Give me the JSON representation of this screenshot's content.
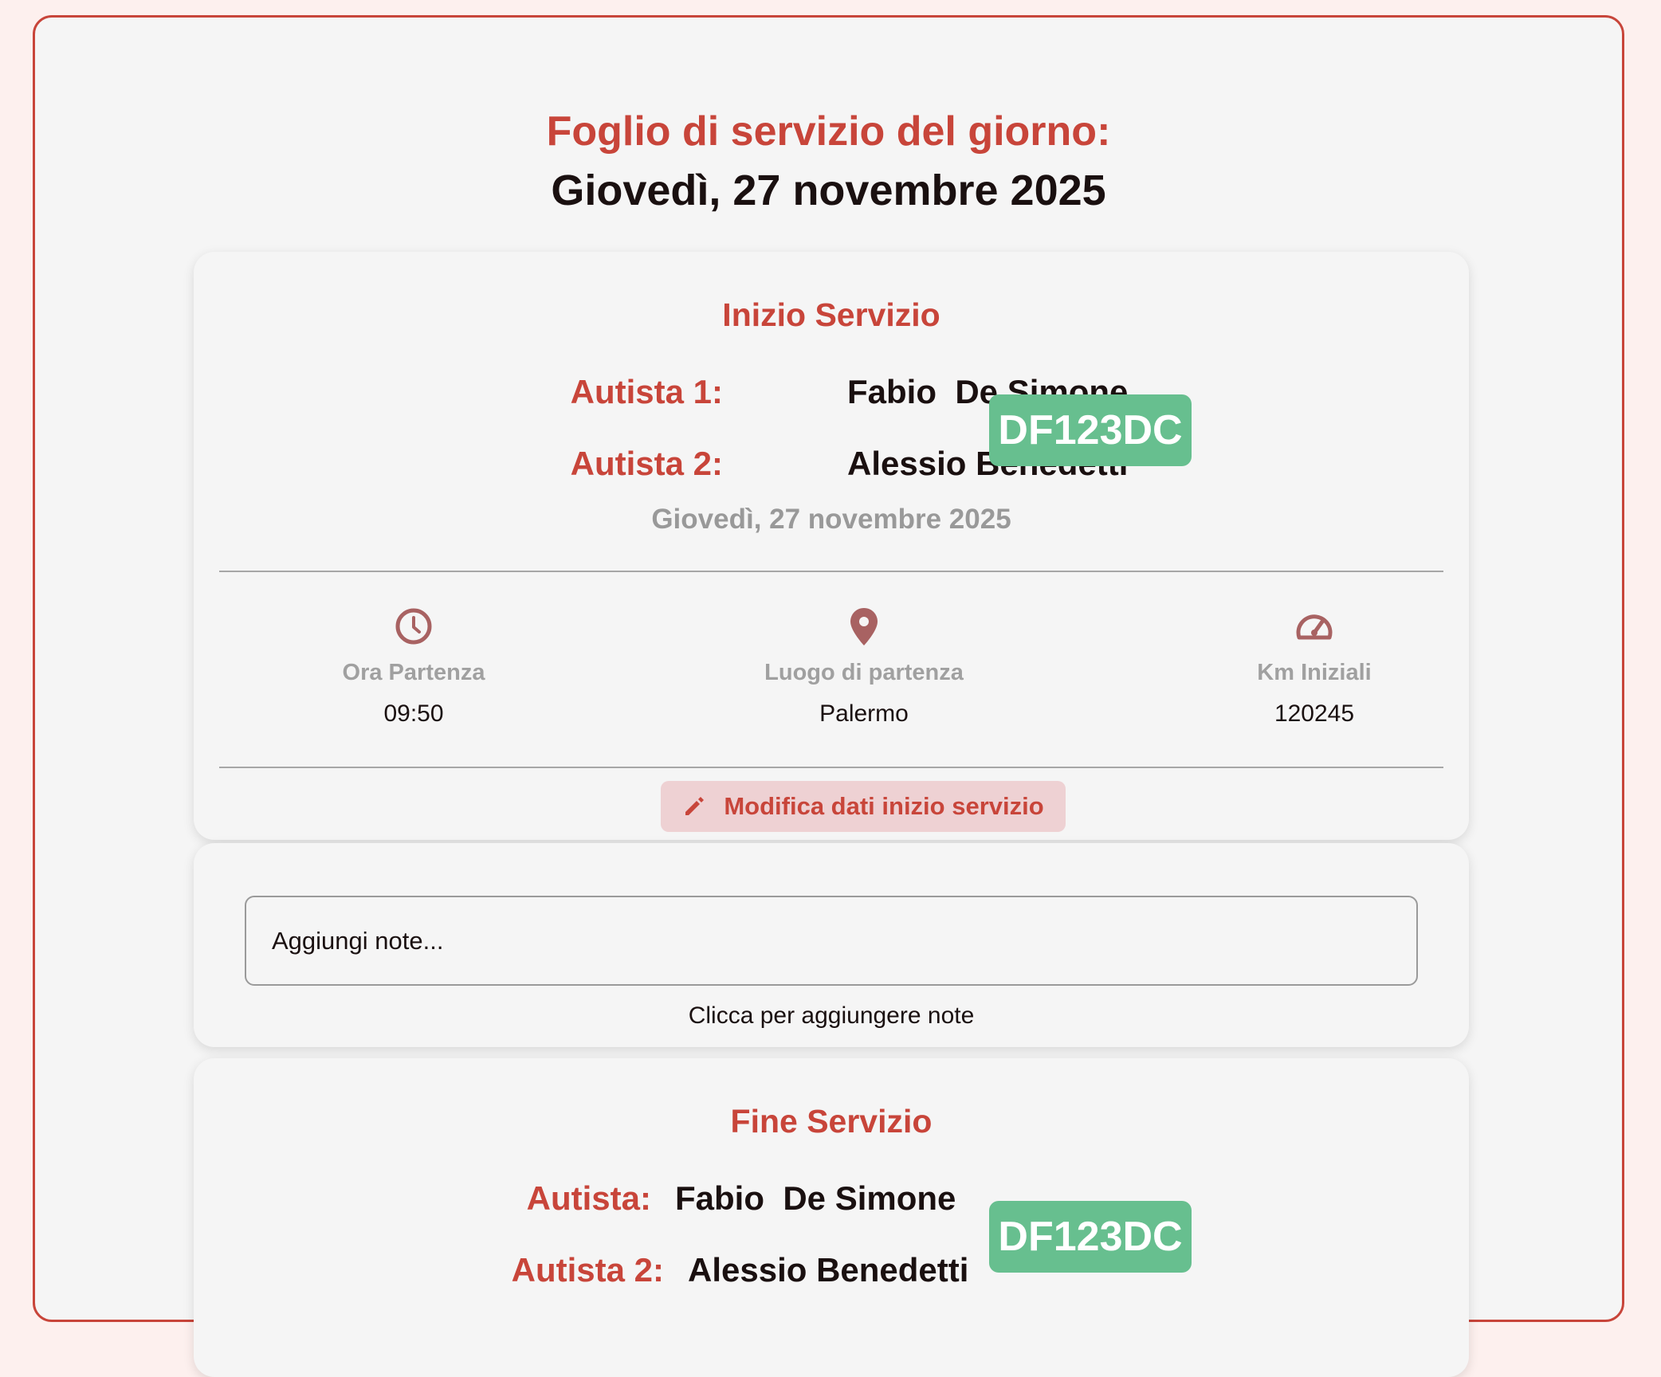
{
  "header": {
    "title": "Foglio di servizio del giorno:",
    "date": "Giovedì, 27 novembre 2025"
  },
  "start_service": {
    "title": "Inizio Servizio",
    "driver1_label": "Autista 1:",
    "driver1_first": "Fabio",
    "driver1_last": "De Simone",
    "driver2_label": "Autista 2:",
    "driver2_name": "Alessio Benedetti",
    "plate": "DF123DC",
    "date": "Giovedì, 27 novembre 2025",
    "departure_time_label": "Ora Partenza",
    "departure_time": "09:50",
    "departure_place_label": "Luogo di partenza",
    "departure_place": "Palermo",
    "km_label": "Km Iniziali",
    "km_value": "120245",
    "edit_button": "Modifica dati inizio servizio"
  },
  "notes": {
    "placeholder": "Aggiungi note...",
    "hint": "Clicca per aggiungere note"
  },
  "end_service": {
    "title": "Fine Servizio",
    "driver_label": "Autista:",
    "driver_first": "Fabio",
    "driver_last": "De Simone",
    "driver2_label": "Autista 2:",
    "driver2_name": "Alessio Benedetti",
    "plate": "DF123DC"
  },
  "icons": {
    "clock": "clock-icon",
    "location": "location-pin-icon",
    "speedometer": "speedometer-icon",
    "edit": "pencil-icon"
  },
  "colors": {
    "accent": "#c8453a",
    "plate": "#67bf8f",
    "icon": "#a86262",
    "button_bg": "#eed1d3"
  }
}
